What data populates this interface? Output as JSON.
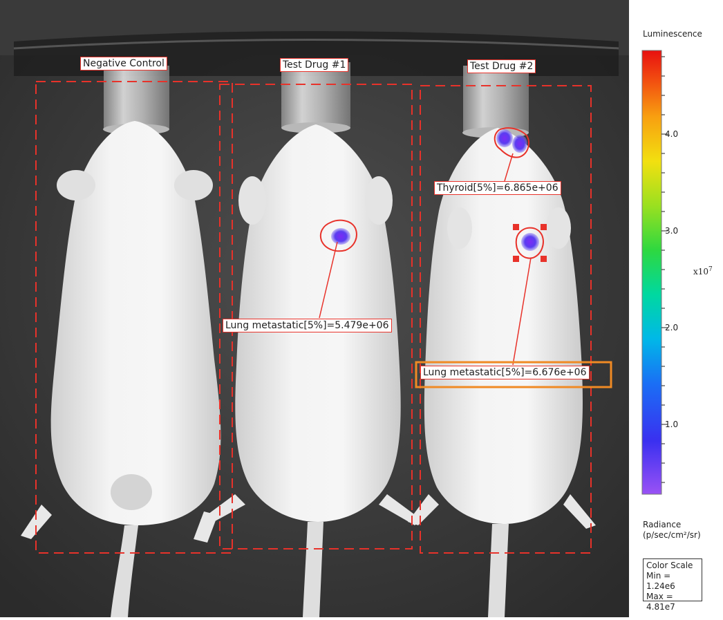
{
  "image": {
    "groups": [
      "Negative Control",
      "Test Drug #1",
      "Test Drug #2"
    ],
    "measurements": [
      {
        "label": "Lung metastatic[5%]=5.479e+06"
      },
      {
        "label": "Thyroid[5%]=6.865e+06"
      },
      {
        "label": "Lung metastatic[5%]=6.676e+06",
        "selected": true
      }
    ]
  },
  "scale": {
    "title": "Luminescence",
    "ticks": [
      "4.0",
      "3.0",
      "2.0",
      "1.0"
    ],
    "exponent_base": "x10",
    "exponent_power": "7",
    "unit_line1": "Radiance",
    "unit_line2": "(p/sec/cm²/sr)",
    "box_title": "Color Scale",
    "min_text": "Min = 1.24e6",
    "max_text": "Max = 4.81e7"
  },
  "colors": {
    "roi": "#e8322a",
    "selected": "#f08a24",
    "signal": "#6a3cf0"
  }
}
